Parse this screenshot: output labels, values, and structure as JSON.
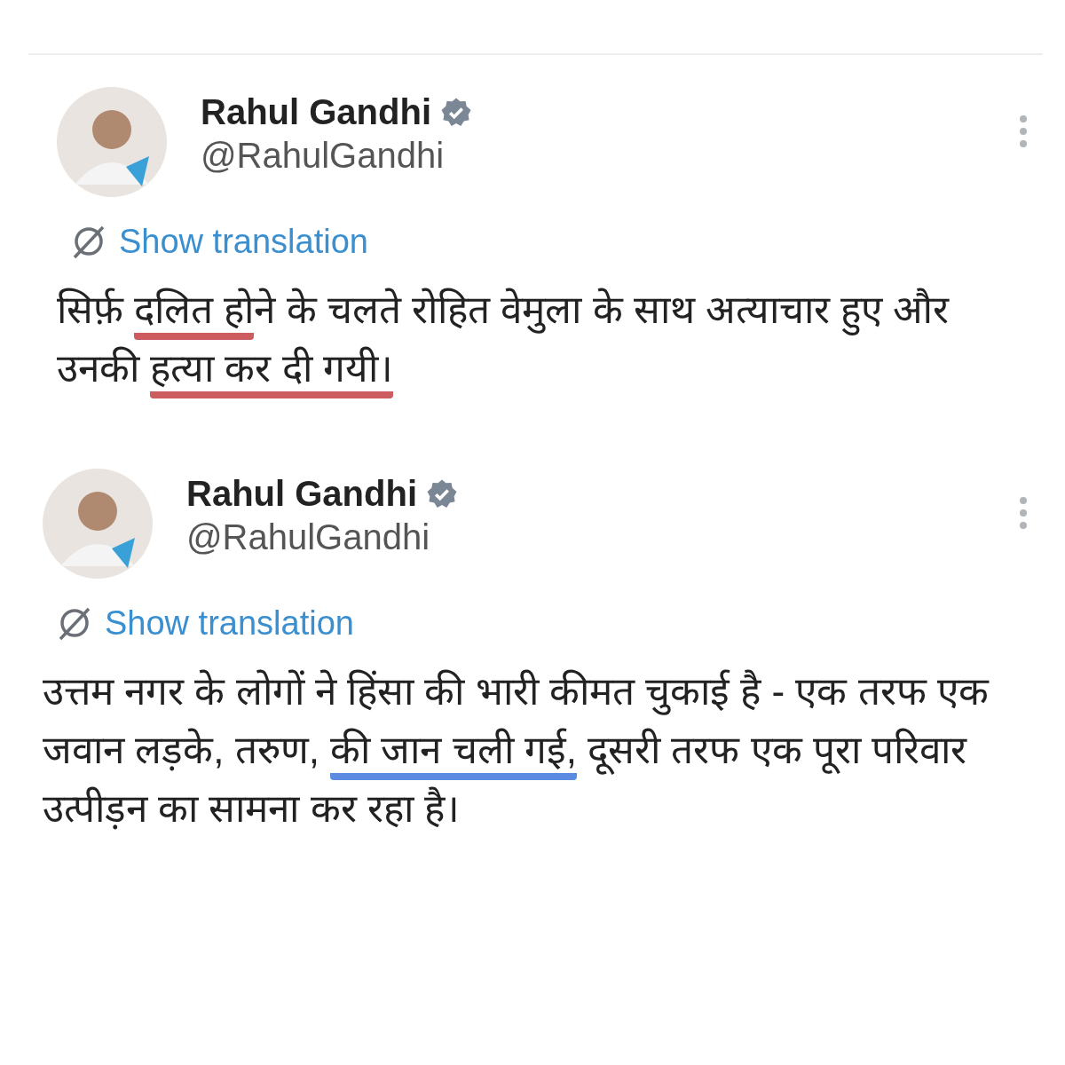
{
  "tweets": [
    {
      "name": "Rahul Gandhi",
      "handle": "@RahulGandhi",
      "verified": true,
      "translate": "Show translation",
      "body": [
        {
          "text": "सिर्फ़ "
        },
        {
          "text": "दलित हो",
          "color": "#cc5c5f"
        },
        {
          "text": "ने के चलते रोहित वेमुला के साथ अत्याचार हुए और उनकी "
        },
        {
          "text": "हत्या कर दी गयी।",
          "color": "#cc5c5f"
        }
      ]
    },
    {
      "name": "Rahul Gandhi",
      "handle": "@RahulGandhi",
      "verified": true,
      "translate": "Show translation",
      "body": [
        {
          "text": "उत्तम नगर के लोगों ने हिंसा की भारी कीमत चुकाई है - एक तरफ एक जवान लड़के, तरुण, "
        },
        {
          "text": "की जान चली गई,",
          "color": "#5a8be0"
        },
        {
          "text": " दूसरी तरफ एक पूरा परिवार उत्पीड़न का सामना कर रहा है।"
        }
      ]
    }
  ]
}
